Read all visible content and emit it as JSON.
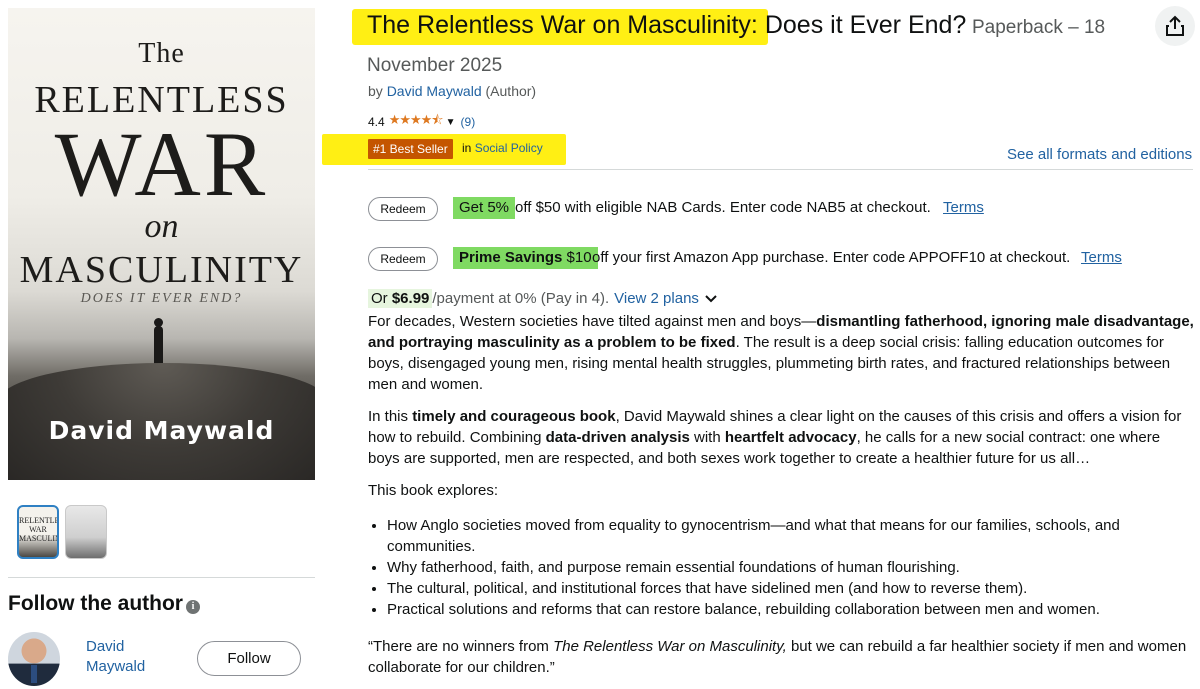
{
  "book": {
    "title": "The Relentless War on Masculinity: Does it Ever End?",
    "title_highlight_part": "The Relentless War on Masculinity:",
    "title_rest_part": " Does it Ever End?",
    "format_label": "Paperback – 18",
    "format_date": "November 2025"
  },
  "cover": {
    "line_the": "The",
    "line_relentless": "RELENTLESS",
    "line_war": "WAR",
    "line_on": "on",
    "line_masculinity": "MASCULINITY",
    "line_subtitle": "DOES IT EVER END?",
    "line_author": "David Maywald"
  },
  "byline": {
    "prefix": "by ",
    "author": "David Maywald",
    "role": " (Author)"
  },
  "rating": {
    "value": "4.4",
    "stars_value": 4.4,
    "stars_glyphs": "★★★★⯪",
    "count": "(9)"
  },
  "bestseller": {
    "badge": "#1 Best Seller",
    "in_prefix": "in ",
    "category": "Social Policy"
  },
  "see_formats_link": "See all formats and editions",
  "promos": [
    {
      "button": "Redeem",
      "tag": "Get 5%",
      "text": " off $50 with eligible NAB Cards. Enter code NAB5 at checkout.",
      "terms": "Terms"
    },
    {
      "button": "Redeem",
      "tag_bold": "Prime Savings",
      "tag_rest": " $10",
      "text": " off your first Amazon App purchase. Enter code APPOFF10 at checkout.",
      "terms": "Terms"
    }
  ],
  "payment": {
    "or": "Or ",
    "price": "$6.99",
    "rest": " /payment at 0% (Pay in 4).",
    "plans_link": "View 2 plans"
  },
  "description": {
    "p1_a": "For decades, Western societies have tilted against men and boys—",
    "p1_bold": "dismantling fatherhood, ignoring male disadvantage, and portraying masculinity as a problem to be fixed",
    "p1_b": ". The result is a deep social crisis: falling education outcomes for boys, disengaged young men, rising mental health struggles, plummeting birth rates, and fractured relationships between men and women.",
    "p2_a": "In this ",
    "p2_bold1": "timely and courageous book",
    "p2_b": ", David Maywald shines a clear light on the causes of this crisis and offers a vision for how to rebuild. Combining ",
    "p2_bold2": "data-driven analysis",
    "p2_c": " with ",
    "p2_bold3": "heartfelt advocacy",
    "p2_d": ", he calls for a new social contract: one where boys are supported, men are respected, and both sexes work together to create a healthier future for us all…",
    "explores_heading": "This book explores:",
    "bullets": [
      "How Anglo societies moved from equality to gynocentrism—and what that means for our families, schools, and communities.",
      "Why fatherhood, faith, and purpose remain essential foundations of human flourishing.",
      "The cultural, political, and institutional forces that have sidelined men (and how to reverse them).",
      "Practical solutions and reforms that can restore balance, rebuilding collaboration between men and women."
    ],
    "quote_a": "“There are no winners from ",
    "quote_italic": "The Relentless War on Masculinity,",
    "quote_b": " but we can rebuild a far healthier society if men and women collaborate for our children.”"
  },
  "follow": {
    "heading": "Follow the author",
    "info_icon_glyph": "i",
    "author_name": "David Maywald",
    "button": "Follow"
  },
  "thumbnails": {
    "thumb1_text": "RELENTLESS WAR MASCULINITY"
  },
  "colors": {
    "highlight": "#ffef14",
    "link": "#2162a1",
    "bestseller_badge": "#c45500",
    "promo_green": "#7fda62",
    "star": "#de7921"
  },
  "icons": [
    "share-icon",
    "info-icon",
    "chevron-down-icon",
    "star-icon"
  ]
}
